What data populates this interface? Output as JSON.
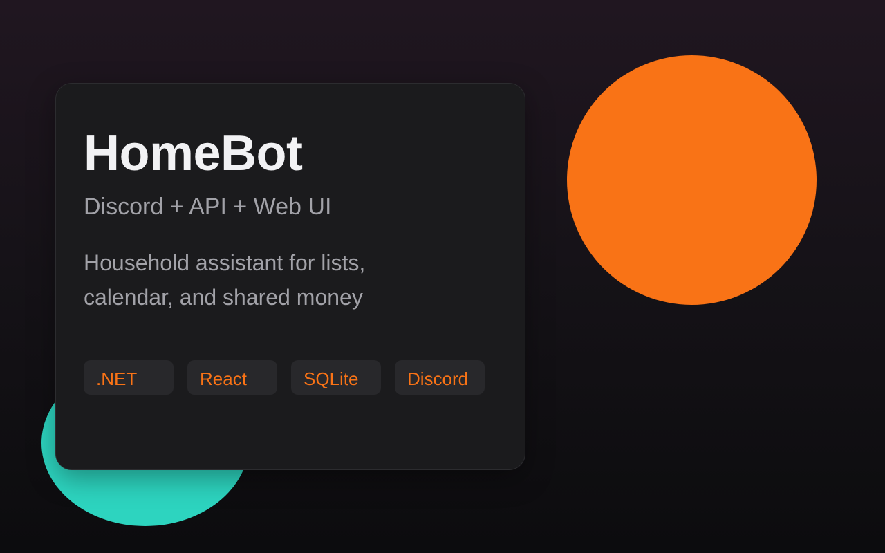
{
  "colors": {
    "accent_orange": "#f97316",
    "accent_teal": "#2dd4bf",
    "card_background": "#1b1b1d",
    "title_text": "#f2f2f4",
    "muted_text": "#a2a2a8",
    "tag_background": "#28282b"
  },
  "project": {
    "title": "HomeBot",
    "subtitle": "Discord + API + Web UI",
    "description": "Household assistant for lists, calendar, and shared money",
    "tags": [
      ".NET",
      "React",
      "SQLite",
      "Discord"
    ]
  }
}
